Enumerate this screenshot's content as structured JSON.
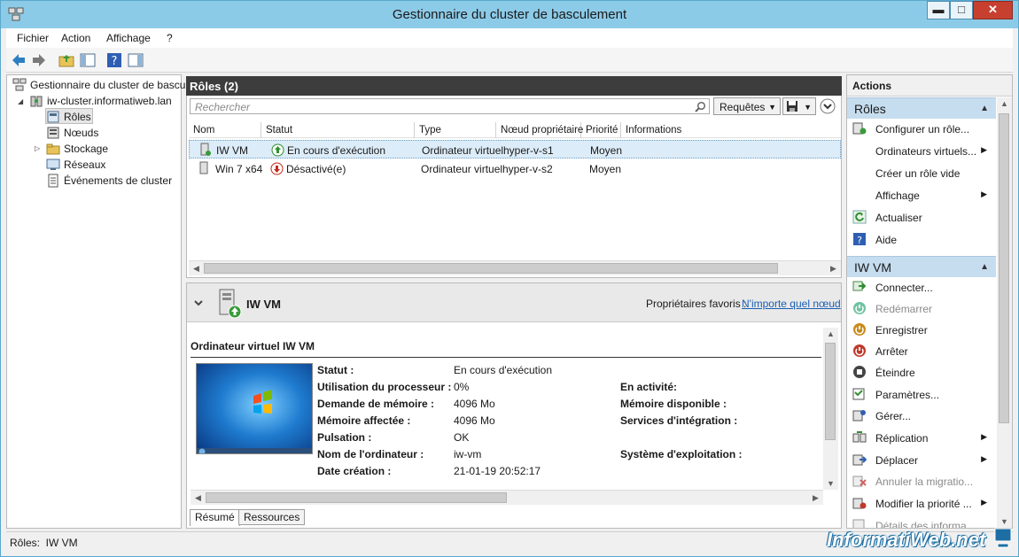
{
  "window": {
    "title": "Gestionnaire du cluster de basculement",
    "minimize": "▬",
    "maximize": "□",
    "close": "✕"
  },
  "menu": [
    "Fichier",
    "Action",
    "Affichage",
    "?"
  ],
  "tree": {
    "root": "Gestionnaire du cluster de bascu",
    "cluster": "iw-cluster.informatiweb.lan",
    "items": [
      "Rôles",
      "Nœuds",
      "Stockage",
      "Réseaux",
      "Événements de cluster"
    ]
  },
  "roles": {
    "header": "Rôles (2)",
    "search_placeholder": "Rechercher",
    "queries_button": "Requêtes",
    "columns": [
      "Nom",
      "Statut",
      "Type",
      "Nœud propriétaire",
      "Priorité",
      "Informations"
    ],
    "rows": [
      {
        "name": "IW VM",
        "status": "En cours d'exécution",
        "type": "Ordinateur virtuel",
        "node": "hyper-v-s1",
        "priority": "Moyen",
        "info": ""
      },
      {
        "name": "Win 7 x64",
        "status": "Désactivé(e)",
        "type": "Ordinateur virtuel",
        "node": "hyper-v-s2",
        "priority": "Moyen",
        "info": ""
      }
    ]
  },
  "detail": {
    "title": "IW VM",
    "preferred_owners_label": "Propriétaires favoris :",
    "preferred_owners_link": "N'importe quel nœud",
    "section_title": "Ordinateur virtuel IW VM",
    "left_fields": [
      {
        "label": "Statut :",
        "value": "En cours d'exécution"
      },
      {
        "label": "Utilisation du processeur :",
        "value": "0%"
      },
      {
        "label": "Demande de mémoire :",
        "value": "4096 Mo"
      },
      {
        "label": "Mémoire affectée :",
        "value": "4096 Mo"
      },
      {
        "label": "Pulsation :",
        "value": "OK"
      },
      {
        "label": "Nom de l'ordinateur :",
        "value": "iw-vm"
      },
      {
        "label": "Date création :",
        "value": "21-01-19 20:52:17"
      }
    ],
    "right_fields": [
      {
        "label": "En activité:",
        "row": 1
      },
      {
        "label": "Mémoire disponible :",
        "row": 2
      },
      {
        "label": "Services d'intégration :",
        "row": 3
      },
      {
        "label": "Système d'exploitation :",
        "row": 5
      }
    ],
    "tabs": [
      "Résumé",
      "Ressources"
    ]
  },
  "actions": {
    "header": "Actions",
    "groups": [
      {
        "title": "Rôles",
        "items": [
          {
            "label": "Configurer un rôle...",
            "icon": "configure-icon",
            "sub": false,
            "disabled": false
          },
          {
            "label": "Ordinateurs virtuels...",
            "icon": "",
            "sub": true,
            "disabled": false
          },
          {
            "label": "Créer un rôle vide",
            "icon": "create-icon",
            "sub": false,
            "disabled": false
          },
          {
            "label": "Affichage",
            "icon": "",
            "sub": true,
            "disabled": false
          },
          {
            "label": "Actualiser",
            "icon": "refresh-icon",
            "sub": false,
            "disabled": false
          },
          {
            "label": "Aide",
            "icon": "help-icon",
            "sub": false,
            "disabled": false
          }
        ]
      },
      {
        "title": "IW VM",
        "items": [
          {
            "label": "Connecter...",
            "icon": "connect-icon",
            "sub": false,
            "disabled": false
          },
          {
            "label": "Redémarrer",
            "icon": "restart-icon",
            "sub": false,
            "disabled": true
          },
          {
            "label": "Enregistrer",
            "icon": "save-state-icon",
            "sub": false,
            "disabled": false
          },
          {
            "label": "Arrêter",
            "icon": "shutdown-icon",
            "sub": false,
            "disabled": false
          },
          {
            "label": "Éteindre",
            "icon": "turn-off-icon",
            "sub": false,
            "disabled": false
          },
          {
            "label": "Paramètres...",
            "icon": "settings-icon",
            "sub": false,
            "disabled": false
          },
          {
            "label": "Gérer...",
            "icon": "manage-icon",
            "sub": false,
            "disabled": false
          },
          {
            "label": "Réplication",
            "icon": "replication-icon",
            "sub": true,
            "disabled": false
          },
          {
            "label": "Déplacer",
            "icon": "move-icon",
            "sub": true,
            "disabled": false
          },
          {
            "label": "Annuler la migratio...",
            "icon": "cancel-migration-icon",
            "sub": false,
            "disabled": true
          },
          {
            "label": "Modifier la priorité ...",
            "icon": "priority-icon",
            "sub": true,
            "disabled": false
          },
          {
            "label": "Détails des informa...",
            "icon": "details-icon",
            "sub": false,
            "disabled": true
          }
        ]
      }
    ]
  },
  "status_bar": "Rôles:  IW VM",
  "watermark": "InformatiWeb.net"
}
